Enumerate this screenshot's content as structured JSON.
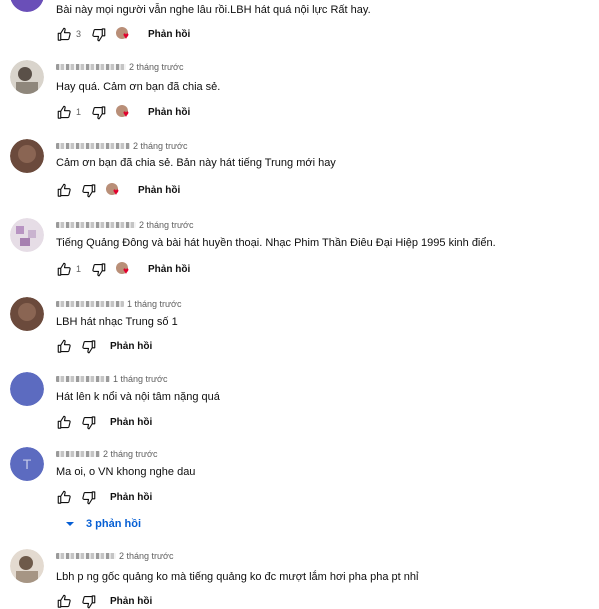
{
  "reply_label": "Phản hồi",
  "comments": [
    {
      "time": "",
      "text": "Bài này mọi người vẫn nghe lâu rồi.LBH hát quá nội lực Rất hay.",
      "likes": "3",
      "heart": true
    },
    {
      "time": "2 tháng trước",
      "text": "Hay quá. Cảm ơn bạn đã chia sẻ.",
      "likes": "1",
      "heart": true
    },
    {
      "time": "2 tháng trước",
      "text": "Cảm ơn bạn đã chia sẻ. Bản này hát tiếng Trung mới hay",
      "likes": "",
      "heart": true
    },
    {
      "time": "2 tháng trước",
      "text": "Tiếng Quảng Đông và bài hát huyền thoại. Nhạc Phim Thần Điêu Đại Hiệp 1995 kinh điển.",
      "likes": "1",
      "heart": true
    },
    {
      "time": "1 tháng trước",
      "text": "LBH hát nhạc Trung số 1",
      "likes": "",
      "heart": false
    },
    {
      "time": "1 tháng trước",
      "text": "Hát lên k nổi và nội tâm nặng quá",
      "likes": "",
      "heart": false
    },
    {
      "time": "2 tháng trước",
      "text": "Ma oi, o VN khong nghe dau",
      "likes": "",
      "heart": false
    },
    {
      "time": "2 tháng trước",
      "text": "Lbh p ng gốc quảng ko mà tiếng quảng ko đc mượt lắm hơi pha pha pt nhỉ",
      "likes": "",
      "heart": false
    }
  ],
  "replies_toggle": "3 phản hồi",
  "icons": {
    "like": "thumb-up-icon",
    "dislike": "thumb-down-icon",
    "creator_heart": "creator-heart-icon",
    "expand": "chevron-down-icon"
  },
  "colors": {
    "link_blue": "#065fd4",
    "heart_red": "#e1002d",
    "text_primary": "#0f0f0f",
    "text_secondary": "#606060"
  }
}
